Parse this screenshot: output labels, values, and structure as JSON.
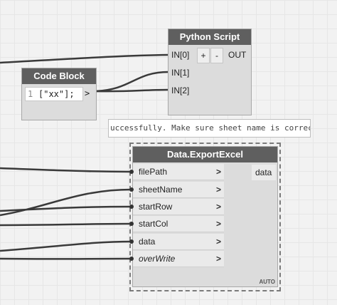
{
  "python_node": {
    "title": "Python Script",
    "inputs": [
      "IN[0]",
      "IN[1]",
      "IN[2]"
    ],
    "add_label": "+",
    "remove_label": "-",
    "output": "OUT"
  },
  "code_block": {
    "title": "Code Block",
    "line_number": "1",
    "code": "[\"xx\"];",
    "output_arrow": ">"
  },
  "warning": {
    "text": "uccessfully. Make sure sheet name is correct"
  },
  "export_node": {
    "title": "Data.ExportExcel",
    "inputs": [
      {
        "label": "filePath",
        "arrow": ">"
      },
      {
        "label": "sheetName",
        "arrow": ">"
      },
      {
        "label": "startRow",
        "arrow": ">"
      },
      {
        "label": "startCol",
        "arrow": ">"
      },
      {
        "label": "data",
        "arrow": ">"
      },
      {
        "label": "overWrite",
        "arrow": ">"
      }
    ],
    "output": "data",
    "lacing": "AUTO"
  },
  "colors": {
    "title_bar": "#5f5f5f",
    "wire": "#3a3a3a",
    "canvas": "#f2f2f2"
  }
}
